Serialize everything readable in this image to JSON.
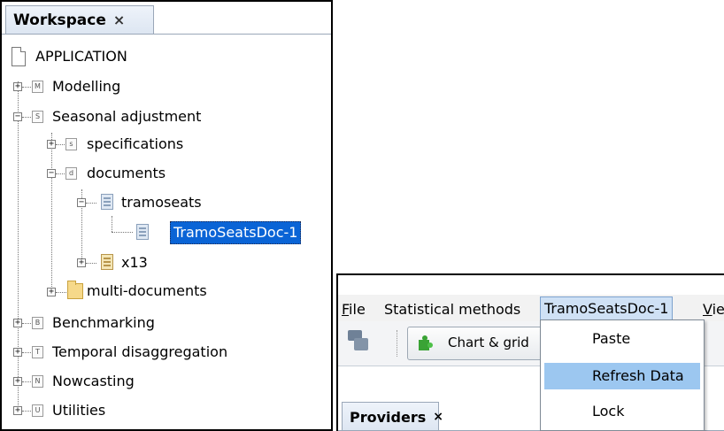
{
  "workspace": {
    "tab_title": "Workspace",
    "tab_close": "×",
    "tree": {
      "root": "APPLICATION",
      "modelling": {
        "label": "Modelling",
        "badge": "M"
      },
      "seasonal": {
        "label": "Seasonal adjustment",
        "badge": "S"
      },
      "specifications": {
        "label": "specifications",
        "badge": "s"
      },
      "documents": {
        "label": "documents",
        "badge": "d"
      },
      "tramoseats": {
        "label": "tramoseats"
      },
      "selected_doc": {
        "label": "TramoSeatsDoc-1"
      },
      "x13": {
        "label": "x13"
      },
      "multi_documents": {
        "label": "multi-documents"
      },
      "benchmarking": {
        "label": "Benchmarking",
        "badge": "B"
      },
      "temporal": {
        "label": "Temporal disaggregation",
        "badge": "T"
      },
      "nowcasting": {
        "label": "Nowcasting",
        "badge": "N"
      },
      "utilities": {
        "label": "Utilities",
        "badge": "U"
      },
      "expander_plus": "+",
      "expander_minus": "−"
    }
  },
  "menubar": {
    "file_mnemonic": "F",
    "file_rest": "ile",
    "statistical": "Statistical methods",
    "doc_menu": "TramoSeatsDoc-1",
    "view_mnemonic": "V",
    "view_rest": "iew"
  },
  "toolbar": {
    "chart_grid": "Chart & grid"
  },
  "providers": {
    "tab_title": "Providers",
    "tab_close": "×"
  },
  "dropdown": {
    "items": [
      "Paste",
      "Refresh Data",
      "Lock"
    ],
    "hovered": "Refresh Data"
  },
  "colors": {
    "selection": "#0a64d6",
    "menu_hover": "#9cc7f0",
    "menu_open": "#cfe1f5"
  },
  "icons": [
    "computer-icon",
    "puzzle-icon",
    "page-icon",
    "document-icon",
    "folder-icon",
    "expander-icon"
  ]
}
